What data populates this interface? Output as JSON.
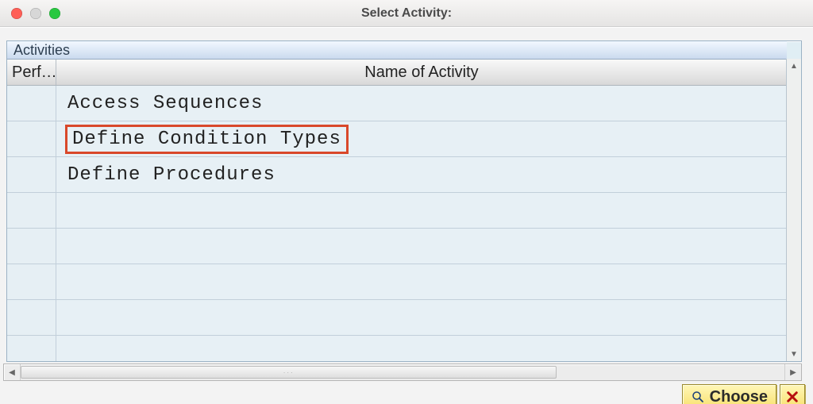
{
  "window": {
    "title": "Select Activity:"
  },
  "section": {
    "title": "Activities"
  },
  "columns": {
    "perf": "Perf…",
    "name": "Name of Activity"
  },
  "rows": [
    {
      "name": "Access Sequences",
      "highlighted": false
    },
    {
      "name": "Define Condition Types",
      "highlighted": true
    },
    {
      "name": "Define Procedures",
      "highlighted": false
    }
  ],
  "empty_row_count": 5,
  "buttons": {
    "choose": "Choose"
  },
  "icons": {
    "search": "search-icon",
    "cancel": "cancel-icon"
  }
}
